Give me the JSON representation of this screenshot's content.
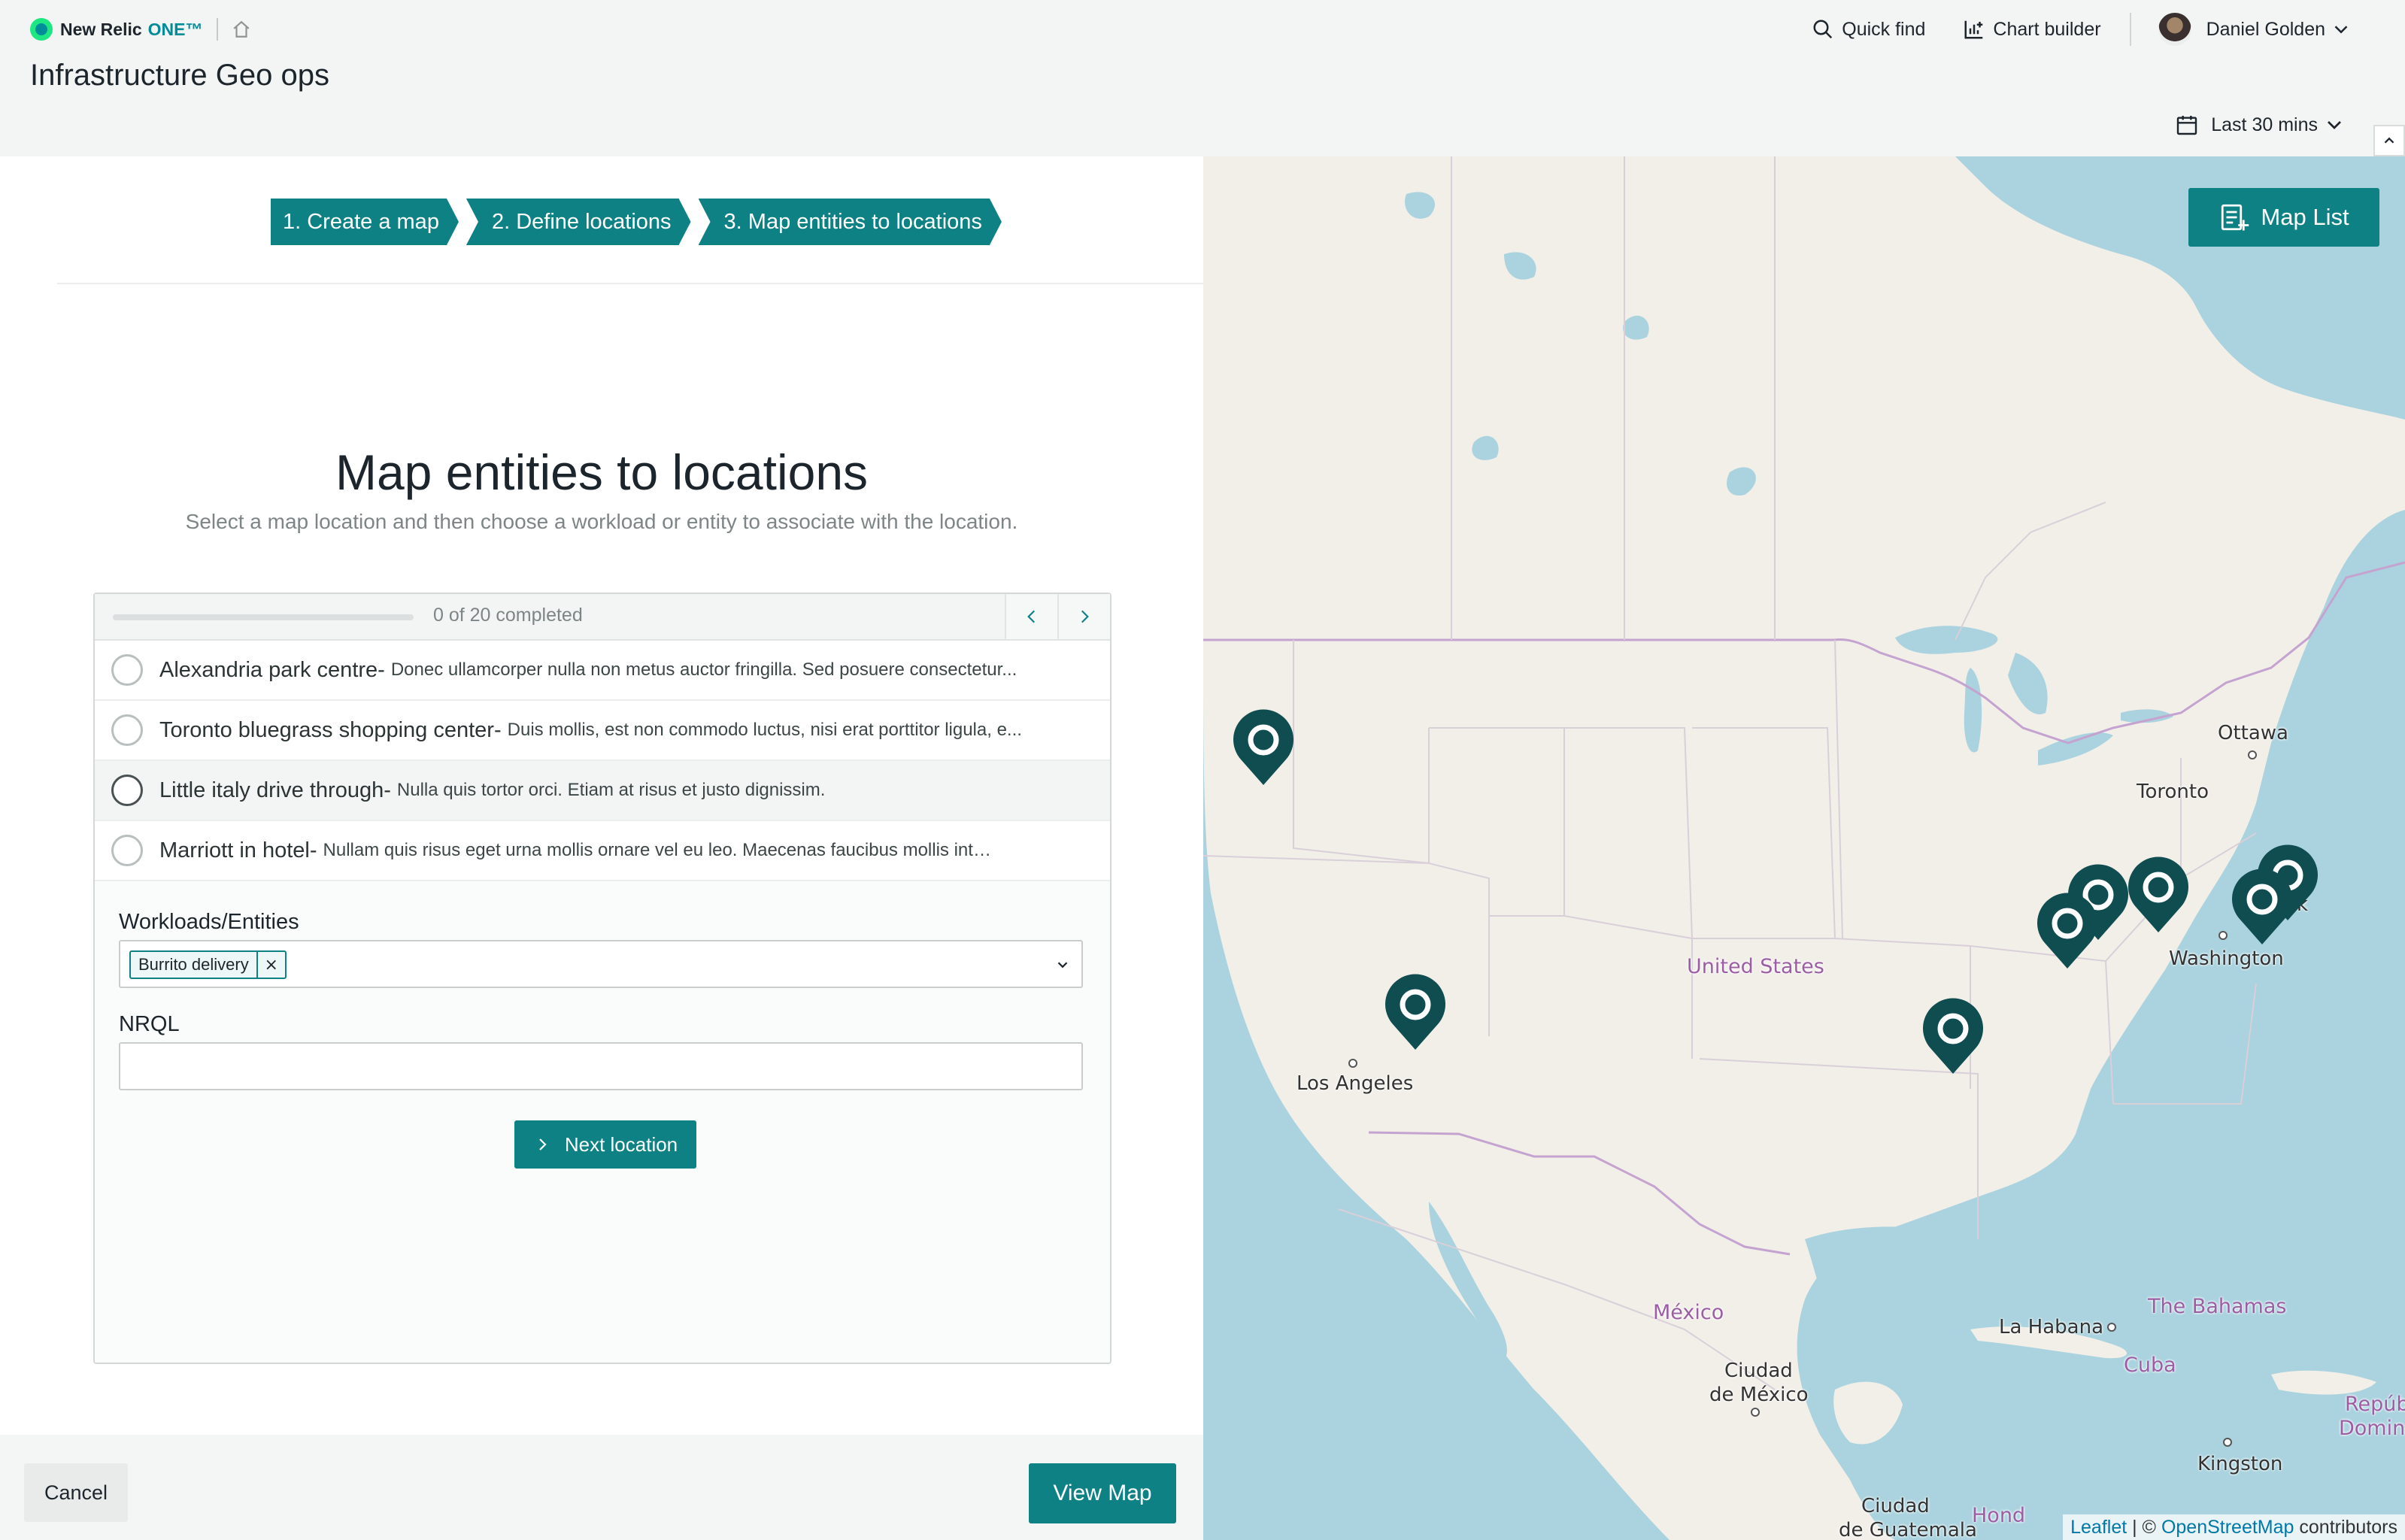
{
  "brand": {
    "name": "New Relic",
    "one": "ONE™"
  },
  "page": {
    "title": "Infrastructure Geo ops"
  },
  "top_actions": {
    "quick_find": "Quick find",
    "chart_builder": "Chart builder",
    "user_name": "Daniel Golden"
  },
  "time_picker": {
    "label": "Last 30 mins"
  },
  "steps": [
    "1. Create a map",
    "2. Define locations",
    "3. Map entities to locations"
  ],
  "main": {
    "heading": "Map entities to locations",
    "subheading": "Select a map location and then choose a workload or entity to associate with the location."
  },
  "progress": {
    "text": "0 of 20 completed",
    "completed": 0,
    "total": 20
  },
  "locations": [
    {
      "name": "Alexandria park centre",
      "separator": " - ",
      "description": "Donec ullamcorper nulla non metus auctor fringilla. Sed posuere consectetur..."
    },
    {
      "name": "Toronto bluegrass shopping center",
      "separator": " - ",
      "description": "Duis mollis, est non commodo luctus, nisi erat porttitor ligula, e..."
    },
    {
      "name": "Little italy drive through",
      "separator": " - ",
      "description": "Nulla quis tortor orci. Etiam at risus et justo dignissim."
    },
    {
      "name": "Marriott in hotel",
      "separator": " - ",
      "description": "Nullam quis risus eget urna mollis ornare vel eu leo. Maecenas faucibus mollis interdum."
    }
  ],
  "form": {
    "workloads_label": "Workloads/Entities",
    "selected_tag": "Burrito delivery",
    "tag_remove": "×",
    "nrql_label": "NRQL",
    "nrql_value": "",
    "next_button": "Next location"
  },
  "footer": {
    "cancel": "Cancel",
    "view_map": "View Map"
  },
  "map": {
    "map_list_button": "Map List",
    "labels": {
      "ottawa": "Ottawa",
      "toronto": "Toronto",
      "washington": "Washington",
      "united_states": "United States",
      "los_angeles": "Los Angeles",
      "mexico": "México",
      "ciudad_de_mexico_1": "Ciudad",
      "ciudad_de_mexico_2": "de México",
      "la_habana": "La Habana",
      "the_bahamas": "The Bahamas",
      "cuba": "Cuba",
      "kingston": "Kingston",
      "republica": "Repúbli",
      "dominicana": "Dominica",
      "ciudad_guatemala_1": "Ciudad",
      "ciudad_guatemala_2": "de Guatemala",
      "hond": "Hond",
      "york_fragment": "k"
    },
    "attribution": {
      "leaflet": "Leaflet",
      "sep": " | © ",
      "osm": "OpenStreetMap",
      "contributors": " contributors"
    }
  },
  "colors": {
    "accent": "#0e8185",
    "map_water": "#aad3df",
    "map_land": "#f2efe9",
    "pin": "#0f4d51"
  }
}
